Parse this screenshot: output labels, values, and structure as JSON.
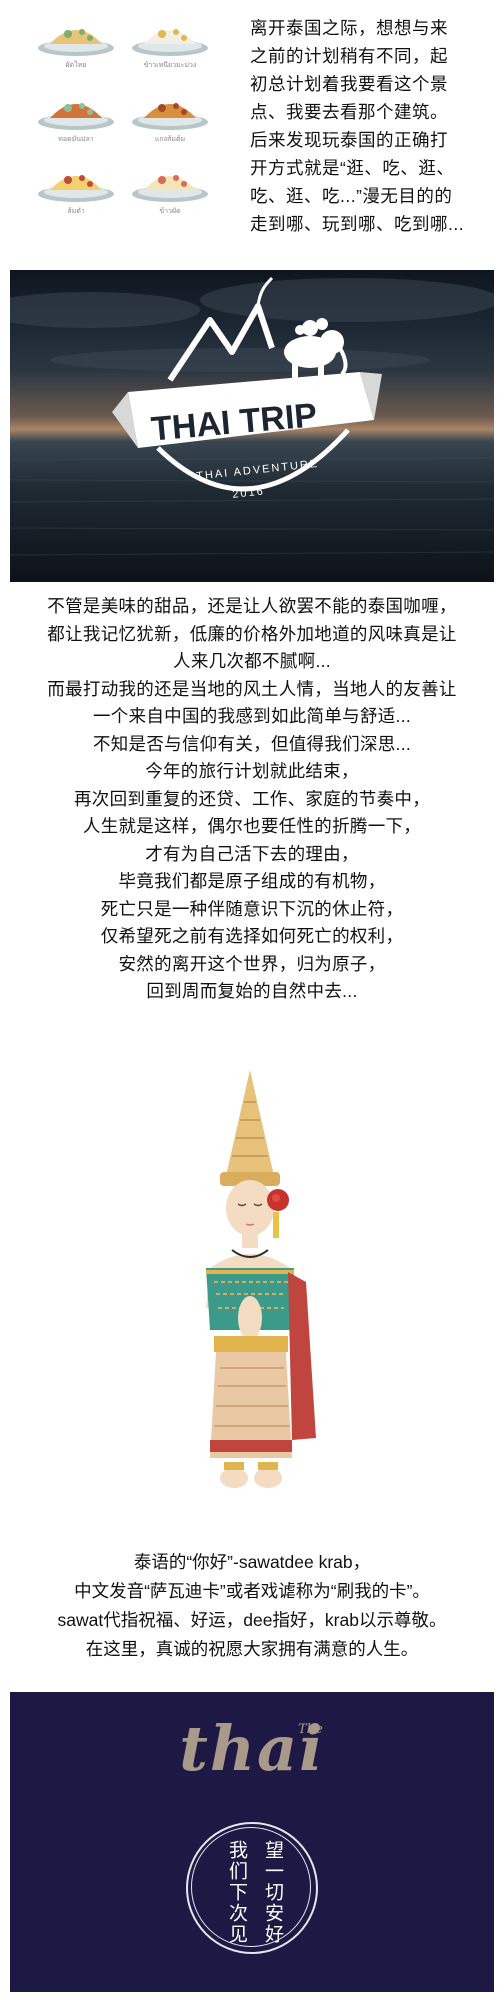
{
  "intro": {
    "food_items": [
      {
        "caption": "ผัดไทย",
        "icon": "pad-thai-icon"
      },
      {
        "caption": "ข้าวเหนียวมะม่วง",
        "icon": "mango-sticky-rice-icon"
      },
      {
        "caption": "ทอดมันปลา",
        "icon": "fish-cake-icon"
      },
      {
        "caption": "แกงส้มต้ม",
        "icon": "tom-yum-icon"
      },
      {
        "caption": "ส้มตำ",
        "icon": "papaya-salad-icon"
      },
      {
        "caption": "ข้าวผัด",
        "icon": "fried-rice-icon"
      }
    ],
    "paragraph_lines": [
      "离开泰国之际，想想与来",
      "之前的计划稍有不同，起",
      "初总计划着我要看这个景",
      "点、我要去看那个建筑。",
      "后来发现玩泰国的正确打",
      "开方式就是“逛、吃、逛、",
      "吃、逛、吃...”漫无目的的",
      "走到哪、玩到哪、吃到哪..."
    ]
  },
  "hero": {
    "title": "THAI TRIP",
    "subtitle": "THAI ADVENTURE",
    "year": "2016"
  },
  "story_lines": [
    "不管是美味的甜品，还是让人欲罢不能的泰国咖喱，",
    "都让我记忆犹新，低廉的价格外加地道的风味真是让",
    "人来几次都不腻啊...",
    "而最打动我的还是当地的风土人情，当地人的友善让",
    "一个来自中国的我感到如此简单与舒适...",
    "不知是否与信仰有关，但值得我们深思...",
    "今年的旅行计划就此结束，",
    "再次回到重复的还贷、工作、家庭的节奏中，",
    "人生就是这样，偶尔也要任性的折腾一下，",
    "才有为自己活下去的理由，",
    "毕竟我们都是原子组成的有机物，",
    "死亡只是一种伴随意识下沉的休止符，",
    "仅希望死之前有选择如何死亡的权利，",
    "安然的离开这个世界，归为原子，",
    "回到周而复始的自然中去..."
  ],
  "greeting_lines": [
    "泰语的“你好”-sawatdee krab，",
    "中文发音“萨瓦迪卡”或者戏谑称为“刷我的卡”。",
    "sawat代指祝福、好运，dee指好，krab以示尊敬。",
    "在这里，真诚的祝愿大家拥有满意的人生。"
  ],
  "footer": {
    "brand": "thai",
    "brand_small": "The",
    "col_right": "望一切安好",
    "col_left": "我们下次见",
    "background": "#1e1845"
  }
}
